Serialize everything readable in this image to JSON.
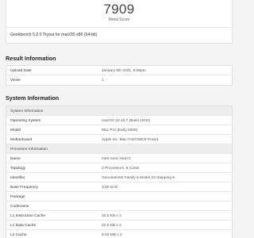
{
  "score": {
    "value": "7909",
    "label": "Metal Score",
    "footer": "Geekbench 5.2.0 Tryout for macOS x86 (64-bit)"
  },
  "result_information": {
    "heading": "Result Information",
    "rows": [
      {
        "label": "Upload Date",
        "value": "January 6th 2021, 8:29pm"
      },
      {
        "label": "Views",
        "value": "1"
      }
    ]
  },
  "system_information": {
    "heading": "System Information",
    "system_group": "System Information",
    "system_rows": [
      {
        "label": "Operating System",
        "value": "macOS 10.15.7 (Build 19H2)"
      },
      {
        "label": "Model",
        "value": "Mac Pro (Early 2008)"
      },
      {
        "label": "Motherboard",
        "value": "Apple Inc. Mac-F42C88C8 Proto1"
      }
    ],
    "processor_group": "Processor Information",
    "processor_rows": [
      {
        "label": "Name",
        "value": "Intel Xeon X5472"
      },
      {
        "label": "Topology",
        "value": "2 Processors, 8 Cores"
      },
      {
        "label": "Identifier",
        "value": "GenuineIntel Family 6 Model 23 Stepping 6"
      },
      {
        "label": "Base Frequency",
        "value": "3.00 GHz"
      },
      {
        "label": "Package",
        "value": ""
      },
      {
        "label": "Codename",
        "value": ""
      },
      {
        "label": "L1 Instruction Cache",
        "value": "32.0 KB x 4"
      },
      {
        "label": "L1 Data Cache",
        "value": "32.0 KB x 4"
      },
      {
        "label": "L2 Cache",
        "value": "6.00 MB x 2"
      }
    ]
  }
}
